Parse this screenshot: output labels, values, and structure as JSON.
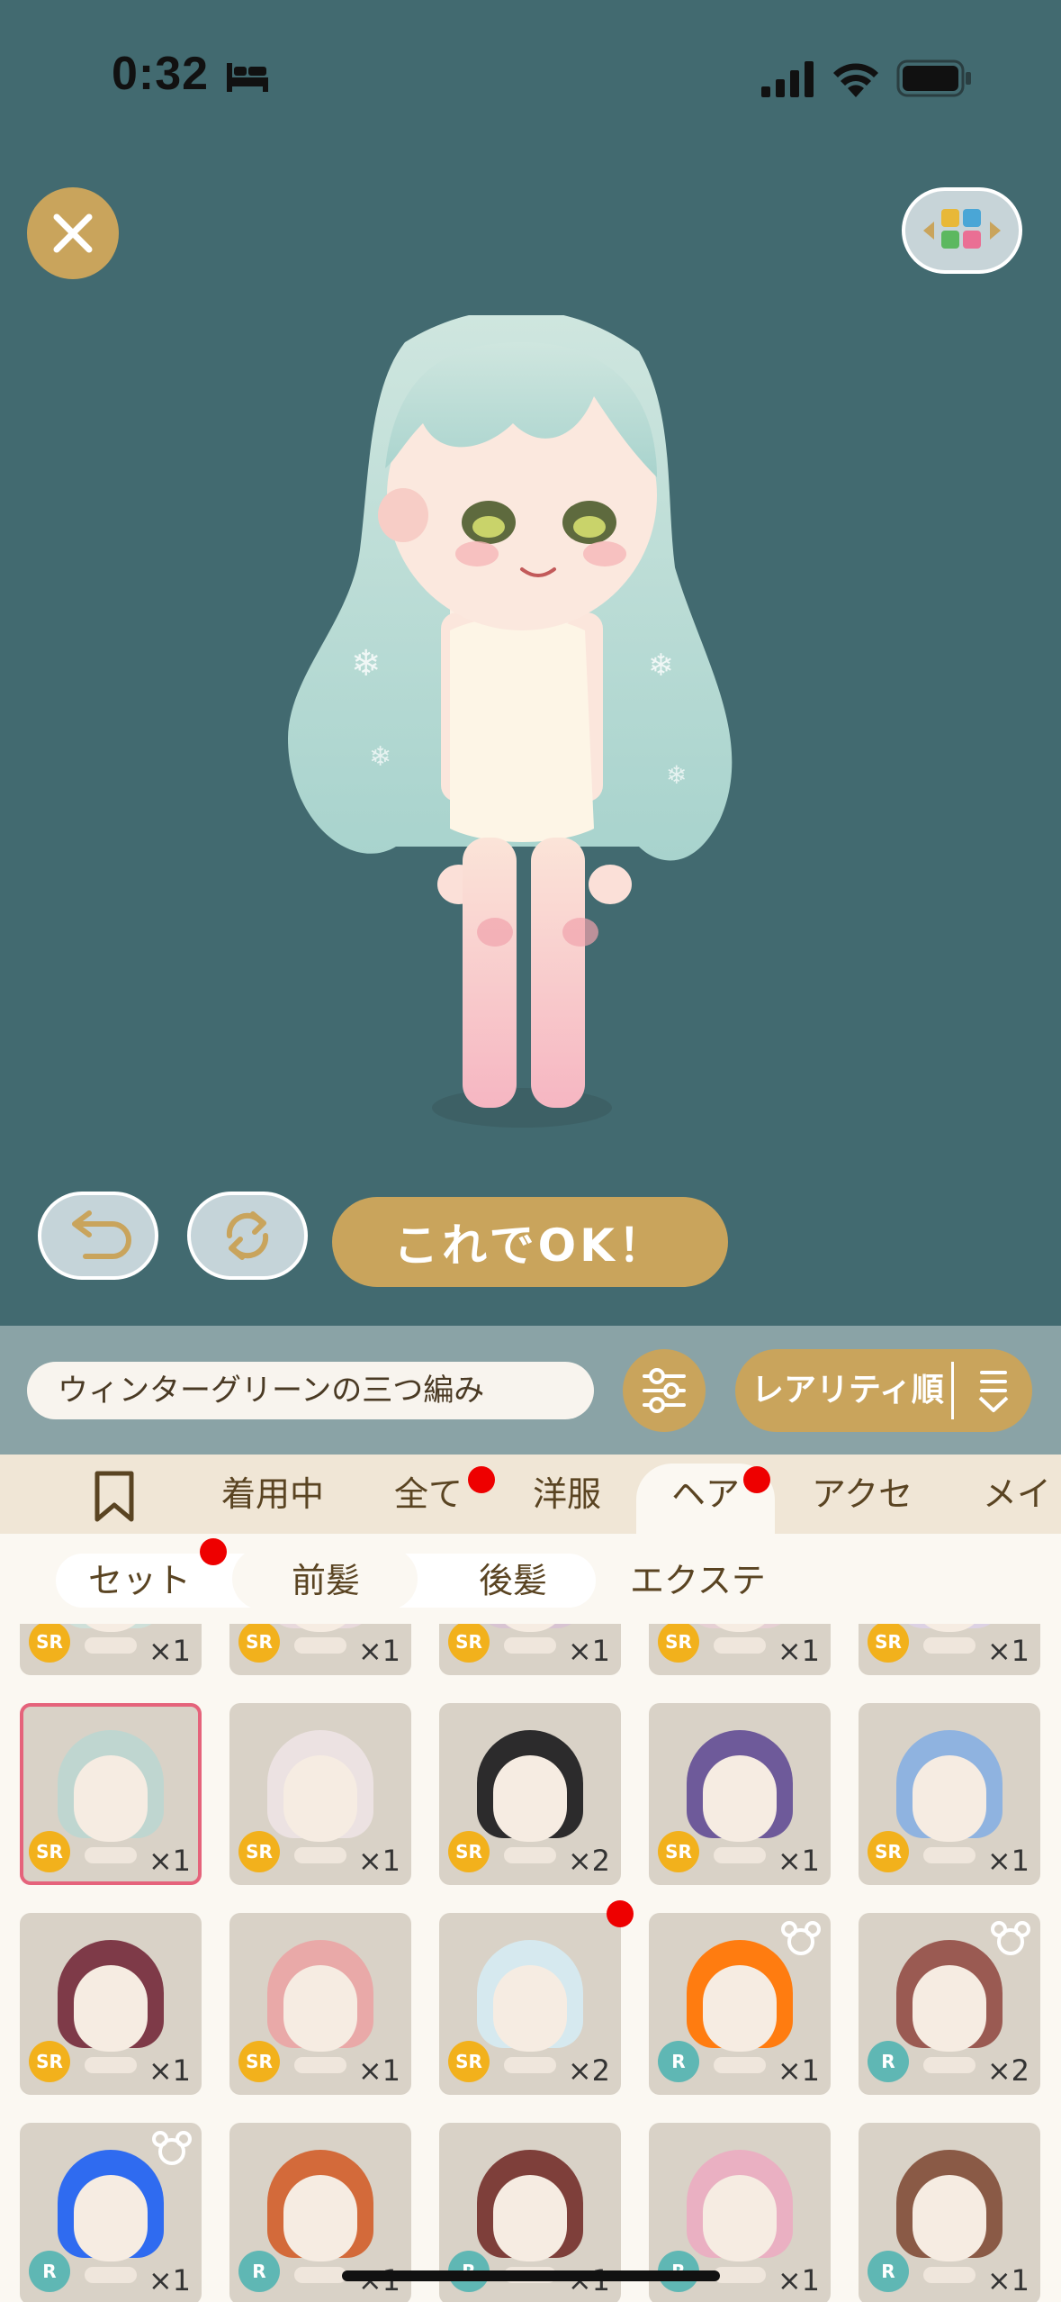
{
  "status_bar": {
    "time": "0:32"
  },
  "controls": {
    "ok_label": "これでOK！"
  },
  "filter": {
    "item_name": "ウィンターグリーンの三つ編み",
    "sort_label": "レアリティ順"
  },
  "category_tabs": [
    {
      "label": "着用中"
    },
    {
      "label": "全て"
    },
    {
      "label": "洋服"
    },
    {
      "label": "ヘア"
    },
    {
      "label": "アクセ"
    },
    {
      "label": "メイク"
    }
  ],
  "sub_tabs": [
    {
      "label": "セット"
    },
    {
      "label": "前髪"
    },
    {
      "label": "後髪"
    },
    {
      "label": "エクステ"
    }
  ],
  "colors": {
    "background": "#426a70",
    "accent": "#c9a45c",
    "sr_badge": "#f2b11c",
    "r_badge": "#5fb7b4"
  },
  "items": [
    {
      "rarity": "SR",
      "count": "×1",
      "hair": "#cfe0d9"
    },
    {
      "rarity": "SR",
      "count": "×1",
      "hair": "#e8d9dc"
    },
    {
      "rarity": "SR",
      "count": "×1",
      "hair": "#d8c4d2"
    },
    {
      "rarity": "SR",
      "count": "×1",
      "hair": "#e6d0d4"
    },
    {
      "rarity": "SR",
      "count": "×1",
      "hair": "#ddd2e4"
    },
    {
      "rarity": "SR",
      "count": "×1",
      "hair": "#bfd6d0",
      "selected": true
    },
    {
      "rarity": "SR",
      "count": "×1",
      "hair": "#ece2e2"
    },
    {
      "rarity": "SR",
      "count": "×2",
      "hair": "#2c2b2c"
    },
    {
      "rarity": "SR",
      "count": "×1",
      "hair": "#6e5a9a"
    },
    {
      "rarity": "SR",
      "count": "×1",
      "hair": "#8fb3e0"
    },
    {
      "rarity": "SR",
      "count": "×1",
      "hair": "#7e3a48"
    },
    {
      "rarity": "SR",
      "count": "×1",
      "hair": "#e9a9a8"
    },
    {
      "rarity": "SR",
      "count": "×2",
      "hair": "#d6e9ef",
      "new": true
    },
    {
      "rarity": "R",
      "count": "×1",
      "hair": "#ff7c10",
      "bear": true
    },
    {
      "rarity": "R",
      "count": "×2",
      "hair": "#9a5a52",
      "bear": true
    },
    {
      "rarity": "R",
      "count": "×1",
      "hair": "#2f6bf0",
      "bear": true
    },
    {
      "rarity": "R",
      "count": "×1",
      "hair": "#d36a3a"
    },
    {
      "rarity": "R",
      "count": "×1",
      "hair": "#7e3f3a"
    },
    {
      "rarity": "R",
      "count": "×1",
      "hair": "#eab0c2"
    },
    {
      "rarity": "R",
      "count": "×1",
      "hair": "#8a5a46"
    }
  ]
}
